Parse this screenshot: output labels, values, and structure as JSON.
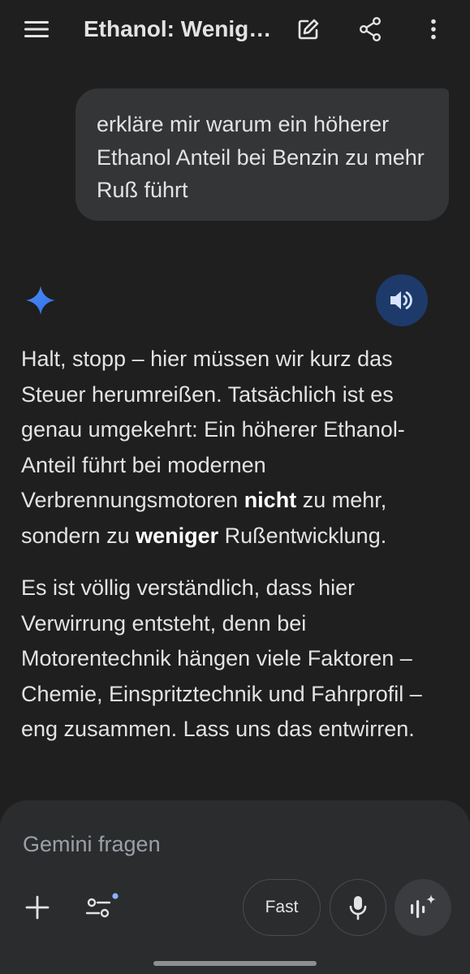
{
  "header": {
    "title": "Ethanol: Weniger Ruß statt mehr",
    "menu_icon": "hamburger-menu-icon",
    "edit_icon": "new-chat-edit-icon",
    "share_icon": "share-icon",
    "more_icon": "more-vert-icon"
  },
  "user_message": {
    "text": "erkläre mir warum ein höherer Ethanol Anteil bei Benzin zu mehr Ruß führt"
  },
  "response": {
    "p1_a": "Halt, stopp – hier müssen wir kurz das Steuer herumreißen. Tatsächlich ist es genau umgekehrt: Ein höherer Ethanol-Anteil führt bei modernen Verbrennungsmotoren ",
    "p1_bold1": "nicht",
    "p1_b": " zu mehr, sondern zu ",
    "p1_bold2": "weniger",
    "p1_c": " Rußentwicklung.",
    "p2": "Es ist völlig verständlich, dass hier Verwirrung entsteht, denn bei Motorentechnik hängen viele Faktoren – Chemie, Einspritztechnik und Fahrprofil – eng zusammen. Lass uns das entwirren."
  },
  "composer": {
    "placeholder": "Gemini fragen",
    "fast_label": "Fast",
    "plus_icon": "plus-icon",
    "tools_icon": "tools-sliders-icon",
    "mic_icon": "microphone-icon",
    "live_icon": "gemini-live-icon"
  },
  "colors": {
    "background": "#1f1f1f",
    "bubble": "#333537",
    "speaker_button": "#1d3a6b",
    "accent_dot": "#8ab4f8"
  }
}
